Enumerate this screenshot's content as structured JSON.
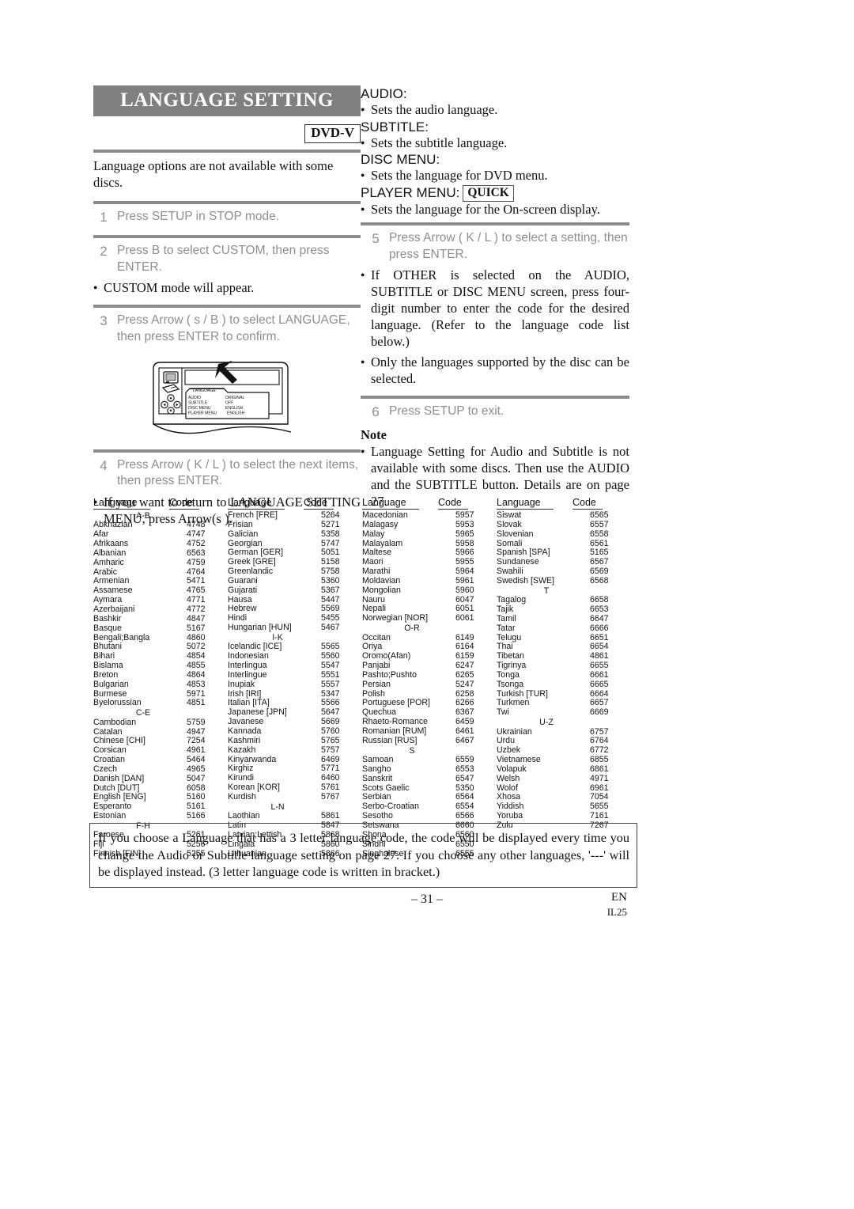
{
  "header": {
    "title": "LANGUAGE SETTING",
    "badge": "DVD-V",
    "intro": "Language options are not available with some discs."
  },
  "left_column": {
    "steps": [
      {
        "num": "1",
        "text": "Press SETUP in STOP mode."
      },
      {
        "num": "2",
        "text": "Press  B  to select CUSTOM, then press ENTER."
      },
      {
        "num": "3",
        "text": "Press Arrow (  s  / B ) to select LANGUAGE, then press ENTER to confirm."
      },
      {
        "num": "4",
        "text": "Press Arrow ( K / L ) to select the next items, then press ENTER."
      }
    ],
    "note_after_step2": "CUSTOM mode will appear.",
    "note_after_step4": "If you want to return to LANGUAGE SETTING MENU, press Arrow(s )."
  },
  "illustration": {
    "menu_title": "LANGUAGE",
    "rows": [
      {
        "label": "AUDIO",
        "value": "ORIGINAL"
      },
      {
        "label": "SUBTITLE",
        "value": "OFF"
      },
      {
        "label": "DISC MENU",
        "value": "ENGLISH"
      },
      {
        "label": "PLAYER MENU",
        "value": "ENGLISH"
      }
    ]
  },
  "right_column": {
    "definitions": [
      {
        "label": "AUDIO:",
        "desc": "Sets the audio language."
      },
      {
        "label": "SUBTITLE:",
        "desc": "Sets the subtitle language."
      },
      {
        "label": "DISC MENU:",
        "desc": "Sets the language for DVD menu."
      },
      {
        "label": "PLAYER MENU:",
        "badge": "QUICK",
        "desc": "Sets the language for the On-screen display."
      }
    ],
    "steps": [
      {
        "num": "5",
        "text": "Press Arrow ( K / L ) to select a setting, then press ENTER."
      },
      {
        "num": "6",
        "text": "Press SETUP to exit."
      }
    ],
    "bullets": [
      "If OTHER is selected on the AUDIO, SUBTITLE or DISC MENU screen, press four-digit number to enter the code for the desired language. (Refer to the language code list below.)",
      "Only the languages supported by the disc can be selected."
    ],
    "note_heading": "Note",
    "note_text": "Language Setting for Audio and Subtitle is not available with some discs. Then use the AUDIO and the SUBTITLE button. Details are on page 27."
  },
  "code_table": {
    "header_language": "Language",
    "header_code": "Code",
    "columns": [
      {
        "entries": [
          {
            "group": "A-B"
          },
          {
            "name": "Abkhazian",
            "code": "4748"
          },
          {
            "name": "Afar",
            "code": "4747"
          },
          {
            "name": "Afrikaans",
            "code": "4752"
          },
          {
            "name": "Albanian",
            "code": "6563"
          },
          {
            "name": "Amharic",
            "code": "4759"
          },
          {
            "name": "Arabic",
            "code": "4764"
          },
          {
            "name": "Armenian",
            "code": "5471"
          },
          {
            "name": "Assamese",
            "code": "4765"
          },
          {
            "name": "Aymara",
            "code": "4771"
          },
          {
            "name": "Azerbaijani",
            "code": "4772"
          },
          {
            "name": "Bashkir",
            "code": "4847"
          },
          {
            "name": "Basque",
            "code": "5167"
          },
          {
            "name": "Bengali;Bangla",
            "code": "4860"
          },
          {
            "name": "Bhutani",
            "code": "5072"
          },
          {
            "name": "Bihari",
            "code": "4854"
          },
          {
            "name": "Bislama",
            "code": "4855"
          },
          {
            "name": "Breton",
            "code": "4864"
          },
          {
            "name": "Bulgarian",
            "code": "4853"
          },
          {
            "name": "Burmese",
            "code": "5971"
          },
          {
            "name": "Byelorussian",
            "code": "4851"
          },
          {
            "group": "C-E"
          },
          {
            "name": "Cambodian",
            "code": "5759"
          },
          {
            "name": "Catalan",
            "code": "4947"
          },
          {
            "name": "Chinese [CHI]",
            "code": "7254"
          },
          {
            "name": "Corsican",
            "code": "4961"
          },
          {
            "name": "Croatian",
            "code": "5464"
          },
          {
            "name": "Czech",
            "code": "4965"
          },
          {
            "name": "Danish [DAN]",
            "code": "5047"
          },
          {
            "name": "Dutch [DUT]",
            "code": "6058"
          },
          {
            "name": "English [ENG]",
            "code": "5160"
          },
          {
            "name": "Esperanto",
            "code": "5161"
          },
          {
            "name": "Estonian",
            "code": "5166"
          },
          {
            "group": "F-H"
          },
          {
            "name": "Faroese",
            "code": "5261"
          },
          {
            "name": "Fiji",
            "code": "5256"
          },
          {
            "name": "Finnish [FIN]",
            "code": "5255"
          }
        ]
      },
      {
        "entries": [
          {
            "name": "French [FRE]",
            "code": "5264"
          },
          {
            "name": "Frisian",
            "code": "5271"
          },
          {
            "name": "Galician",
            "code": "5358"
          },
          {
            "name": "Georgian",
            "code": "5747"
          },
          {
            "name": "German [GER]",
            "code": "5051"
          },
          {
            "name": "Greek [GRE]",
            "code": "5158"
          },
          {
            "name": "Greenlandic",
            "code": "5758"
          },
          {
            "name": "Guarani",
            "code": "5360"
          },
          {
            "name": "Gujarati",
            "code": "5367"
          },
          {
            "name": "Hausa",
            "code": "5447"
          },
          {
            "name": "Hebrew",
            "code": "5569"
          },
          {
            "name": "Hindi",
            "code": "5455"
          },
          {
            "name": "Hungarian [HUN]",
            "code": "5467"
          },
          {
            "group": "I-K"
          },
          {
            "name": "Icelandic [ICE]",
            "code": "5565"
          },
          {
            "name": "Indonesian",
            "code": "5560"
          },
          {
            "name": "Interlingua",
            "code": "5547"
          },
          {
            "name": "Interlingue",
            "code": "5551"
          },
          {
            "name": "Inupiak",
            "code": "5557"
          },
          {
            "name": "Irish [IRI]",
            "code": "5347"
          },
          {
            "name": "Italian [ITA]",
            "code": "5566"
          },
          {
            "name": "Japanese [JPN]",
            "code": "5647"
          },
          {
            "name": "Javanese",
            "code": "5669"
          },
          {
            "name": "Kannada",
            "code": "5760"
          },
          {
            "name": "Kashmiri",
            "code": "5765"
          },
          {
            "name": "Kazakh",
            "code": "5757"
          },
          {
            "name": "Kinyarwanda",
            "code": "6469"
          },
          {
            "name": "Kirghiz",
            "code": "5771"
          },
          {
            "name": "Kirundi",
            "code": "6460"
          },
          {
            "name": "Korean [KOR]",
            "code": "5761"
          },
          {
            "name": "Kurdish",
            "code": "5767"
          },
          {
            "group": "L-N"
          },
          {
            "name": "Laothian",
            "code": "5861"
          },
          {
            "name": "Latin",
            "code": "5847"
          },
          {
            "name": "Latvian;Lettish",
            "code": "5868"
          },
          {
            "name": "Lingala",
            "code": "5860"
          },
          {
            "name": "Lithuanian",
            "code": "5866"
          }
        ]
      },
      {
        "entries": [
          {
            "name": "Macedonian",
            "code": "5957"
          },
          {
            "name": "Malagasy",
            "code": "5953"
          },
          {
            "name": "Malay",
            "code": "5965"
          },
          {
            "name": "Malayalam",
            "code": "5958"
          },
          {
            "name": "Maltese",
            "code": "5966"
          },
          {
            "name": "Maori",
            "code": "5955"
          },
          {
            "name": "Marathi",
            "code": "5964"
          },
          {
            "name": "Moldavian",
            "code": "5961"
          },
          {
            "name": "Mongolian",
            "code": "5960"
          },
          {
            "name": "Nauru",
            "code": "6047"
          },
          {
            "name": "Nepali",
            "code": "6051"
          },
          {
            "name": "Norwegian [NOR]",
            "code": "6061"
          },
          {
            "group": "O-R"
          },
          {
            "name": "Occitan",
            "code": "6149"
          },
          {
            "name": "Oriya",
            "code": "6164"
          },
          {
            "name": "Oromo(Afan)",
            "code": "6159"
          },
          {
            "name": "Panjabi",
            "code": "6247"
          },
          {
            "name": "Pashto;Pushto",
            "code": "6265"
          },
          {
            "name": "Persian",
            "code": "5247"
          },
          {
            "name": "Polish",
            "code": "6258"
          },
          {
            "name": "Portuguese [POR]",
            "code": "6266"
          },
          {
            "name": "Quechua",
            "code": "6367"
          },
          {
            "name": "Rhaeto-Romance",
            "code": "6459"
          },
          {
            "name": "Romanian [RUM]",
            "code": "6461"
          },
          {
            "name": "Russian [RUS]",
            "code": "6467"
          },
          {
            "group": "S"
          },
          {
            "name": "Samoan",
            "code": "6559"
          },
          {
            "name": "Sangho",
            "code": "6553"
          },
          {
            "name": "Sanskrit",
            "code": "6547"
          },
          {
            "name": "Scots Gaelic",
            "code": "5350"
          },
          {
            "name": "Serbian",
            "code": "6564"
          },
          {
            "name": "Serbo-Croatian",
            "code": "6554"
          },
          {
            "name": "Sesotho",
            "code": "6566"
          },
          {
            "name": "Setswana",
            "code": "6660"
          },
          {
            "name": "Shona",
            "code": "6560"
          },
          {
            "name": "Sindhi",
            "code": "6550"
          },
          {
            "name": "Singhalese",
            "code": "6555"
          }
        ]
      },
      {
        "entries": [
          {
            "name": "Siswat",
            "code": "6565"
          },
          {
            "name": "Slovak",
            "code": "6557"
          },
          {
            "name": "Slovenian",
            "code": "6558"
          },
          {
            "name": "Somali",
            "code": "6561"
          },
          {
            "name": "Spanish [SPA]",
            "code": "5165"
          },
          {
            "name": "Sundanese",
            "code": "6567"
          },
          {
            "name": "Swahili",
            "code": "6569"
          },
          {
            "name": "Swedish [SWE]",
            "code": "6568"
          },
          {
            "group": "T"
          },
          {
            "name": "Tagalog",
            "code": "6658"
          },
          {
            "name": "Tajik",
            "code": "6653"
          },
          {
            "name": "Tamil",
            "code": "6647"
          },
          {
            "name": "Tatar",
            "code": "6666"
          },
          {
            "name": "Telugu",
            "code": "6651"
          },
          {
            "name": "Thai",
            "code": "6654"
          },
          {
            "name": "Tibetan",
            "code": "4861"
          },
          {
            "name": "Tigrinya",
            "code": "6655"
          },
          {
            "name": "Tonga",
            "code": "6661"
          },
          {
            "name": "Tsonga",
            "code": "6665"
          },
          {
            "name": "Turkish [TUR]",
            "code": "6664"
          },
          {
            "name": "Turkmen",
            "code": "6657"
          },
          {
            "name": "Twi",
            "code": "6669"
          },
          {
            "group": "U-Z"
          },
          {
            "name": "Ukrainian",
            "code": "6757"
          },
          {
            "name": "Urdu",
            "code": "6764"
          },
          {
            "name": "Uzbek",
            "code": "6772"
          },
          {
            "name": "Vietnamese",
            "code": "6855"
          },
          {
            "name": "Volapuk",
            "code": "6861"
          },
          {
            "name": "Welsh",
            "code": "4971"
          },
          {
            "name": "Wolof",
            "code": "6961"
          },
          {
            "name": "Xhosa",
            "code": "7054"
          },
          {
            "name": "Yiddish",
            "code": "5655"
          },
          {
            "name": "Yoruba",
            "code": "7161"
          },
          {
            "name": "Zulu",
            "code": "7267"
          }
        ]
      }
    ]
  },
  "bottom_note": "If you choose a Language that has a 3 letter language code, the code will be displayed every time you change the Audio or Subtitle language setting on page 27. If you choose any other languages, '---' will be displayed instead. (3 letter language code is written in bracket.)",
  "footer": {
    "page_number": "– 31 –",
    "region": "EN",
    "doc_code": "IL25"
  }
}
